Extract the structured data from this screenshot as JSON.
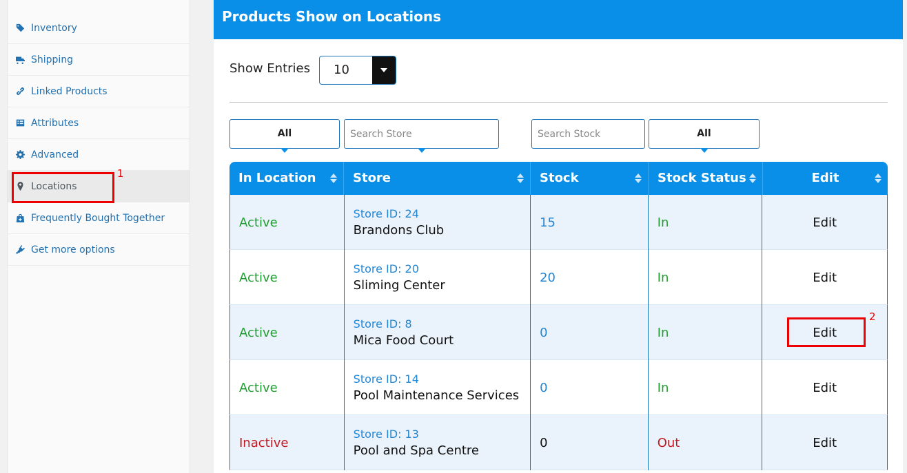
{
  "sidebar": {
    "items": [
      {
        "label": "Inventory",
        "icon": "tag-icon"
      },
      {
        "label": "Shipping",
        "icon": "truck-icon"
      },
      {
        "label": "Linked Products",
        "icon": "link-icon"
      },
      {
        "label": "Attributes",
        "icon": "list-icon"
      },
      {
        "label": "Advanced",
        "icon": "gear-icon"
      },
      {
        "label": "Locations",
        "icon": "map-pin-icon",
        "active": true
      },
      {
        "label": "Frequently Bought Together",
        "icon": "bag-icon"
      },
      {
        "label": "Get more options",
        "icon": "plug-icon"
      }
    ]
  },
  "annotations": {
    "one": "1",
    "two": "2",
    "color": "#ee0000"
  },
  "panel": {
    "title": "Products Show on Locations",
    "show_entries_label": "Show Entries",
    "entries_value": "10"
  },
  "filters": {
    "location_all": "All",
    "store_placeholder": "Search Store",
    "stock_placeholder": "Search Stock",
    "status_all": "All"
  },
  "table": {
    "headers": [
      "In Location",
      "Store",
      "Stock",
      "Stock Status",
      "Edit"
    ],
    "rows": [
      {
        "location": "Active",
        "store_id": "Store ID: 24",
        "store_name": "Brandons Club",
        "stock": "15",
        "status": "In",
        "edit": "Edit"
      },
      {
        "location": "Active",
        "store_id": "Store ID: 20",
        "store_name": "Sliming Center",
        "stock": "20",
        "status": "In",
        "edit": "Edit"
      },
      {
        "location": "Active",
        "store_id": "Store ID: 8",
        "store_name": "Mica Food Court",
        "stock": "0",
        "status": "In",
        "edit": "Edit"
      },
      {
        "location": "Active",
        "store_id": "Store ID: 14",
        "store_name": "Pool Maintenance Services",
        "stock": "0",
        "status": "In",
        "edit": "Edit"
      },
      {
        "location": "Inactive",
        "store_id": "Store ID: 13",
        "store_name": "Pool and Spa Centre",
        "stock": "0",
        "status": "Out",
        "edit": "Edit"
      }
    ]
  },
  "colors": {
    "header_blue": "#0a8fe8",
    "active_green": "#1e9e2e",
    "inactive_red": "#c2191e",
    "link_blue": "#2186d4"
  }
}
